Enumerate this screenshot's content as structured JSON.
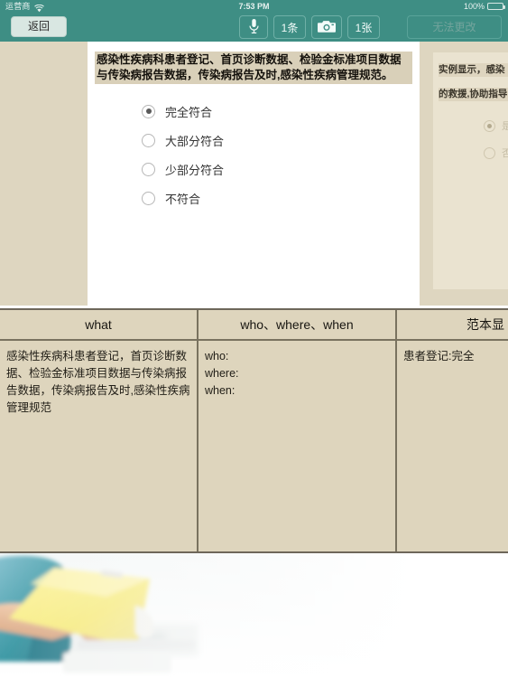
{
  "status_bar": {
    "carrier": "运营商",
    "wifi_icon": "wifi-icon",
    "time": "7:53 PM",
    "battery_percent": "100%"
  },
  "navbar": {
    "back_label": "返回",
    "mic_icon": "microphone-icon",
    "audio_count": "1条",
    "camera_icon": "camera-icon",
    "photo_count": "1张",
    "disabled_label": "无法更改",
    "accent_color": "#3e8e84"
  },
  "question_card": {
    "title": "感染性疾病科患者登记、首页诊断数据、检验金标准项目数据与传染病报告数据，传染病报告及时,感染性疾病管理规范。",
    "highlight_color": "#d9d0b9",
    "options": [
      {
        "label": "完全符合",
        "selected": true
      },
      {
        "label": "大部分符合",
        "selected": false
      },
      {
        "label": "少部分符合",
        "selected": false
      },
      {
        "label": "不符合",
        "selected": false
      }
    ]
  },
  "side_card": {
    "title_line1": "实例显示，感染",
    "title_line2": "的救援,协助指导",
    "options": [
      {
        "label": "是",
        "selected": true
      },
      {
        "label": "否",
        "selected": false
      }
    ]
  },
  "table": {
    "headers": [
      "what",
      "who、where、when",
      "范本显"
    ],
    "rows": [
      {
        "what": "感染性疾病科患者登记，首页诊断数据、检验金标准项目数据与传染病报告数据，传染病报告及时,感染性疾病管理规范",
        "who_where_when": [
          "who:",
          "where:",
          "when:"
        ],
        "sample": "患者登记:完全"
      }
    ],
    "background_color": "#ded5bd",
    "border_color": "#79725f"
  },
  "photo": {
    "alt_name": "nurse-holding-yellow-folder-photo"
  }
}
